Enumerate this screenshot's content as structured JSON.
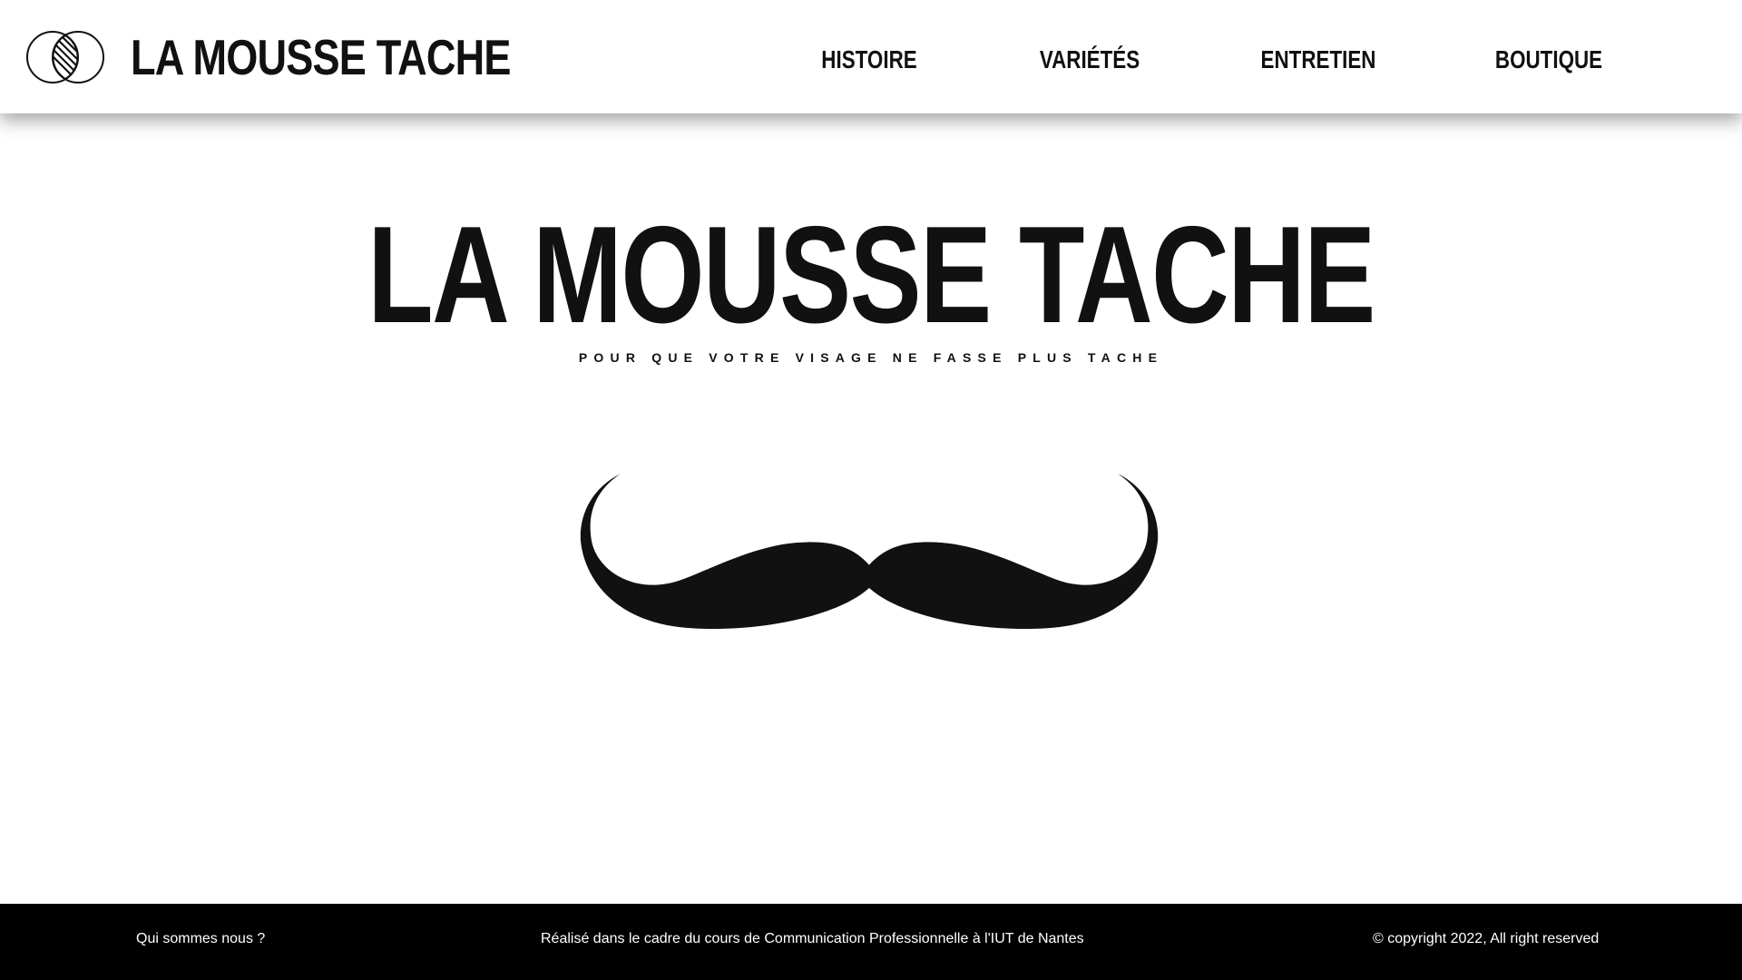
{
  "header": {
    "brand_name": "LA MOUSSE TACHE",
    "logo_icon": "intersecting-circles-logo-icon",
    "nav": [
      {
        "label": "HISTOIRE"
      },
      {
        "label": "VARIÉTÉS"
      },
      {
        "label": "ENTRETIEN"
      },
      {
        "label": "BOUTIQUE"
      }
    ]
  },
  "hero": {
    "title": "LA MOUSSE TACHE",
    "tagline": "POUR QUE VOTRE VISAGE NE FASSE PLUS TACHE",
    "illustration_icon": "mustache-icon"
  },
  "footer": {
    "about_link": "Qui sommes nous ?",
    "credit": "Réalisé dans le cadre du cours de Communication Professionnelle à l'IUT de Nantes",
    "copyright": "© copyright 2022, All right reserved"
  },
  "colors": {
    "background": "#ffffff",
    "text": "#111111",
    "footer_background": "#000000",
    "footer_text": "#ffffff"
  }
}
